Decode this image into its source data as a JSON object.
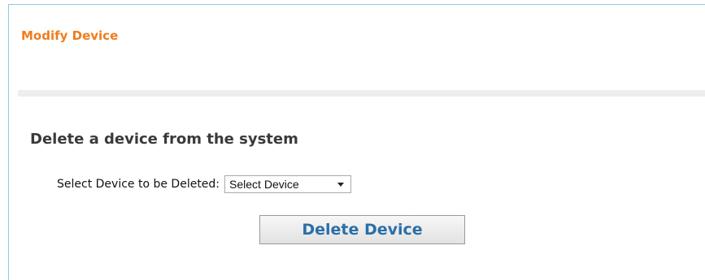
{
  "panel": {
    "title": "Modify Device"
  },
  "delete_section": {
    "heading": "Delete a device from the system",
    "select_label": "Select Device to be Deleted:",
    "select_value": "Select Device",
    "delete_button_label": "Delete Device"
  },
  "colors": {
    "title_orange": "#f07c1c",
    "button_text_blue": "#2a6fa8",
    "frame_border": "#8fc8e8"
  }
}
